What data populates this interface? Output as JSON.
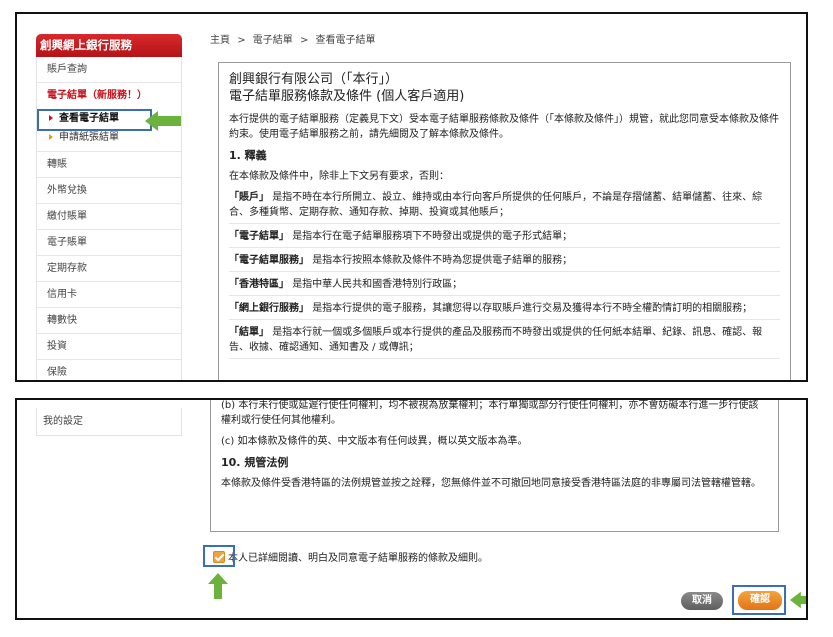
{
  "sidebar": {
    "brand": "創興網上銀行服務",
    "items_top": [
      "賬戶查詢"
    ],
    "active_item": "電子結單（新服務！）",
    "sub_items": [
      "查看電子結單",
      "申請紙張結單"
    ],
    "items": [
      "轉賬",
      "外幣兌換",
      "繳付賬單",
      "電子賬單",
      "定期存款",
      "信用卡",
      "轉數快",
      "投資",
      "保險"
    ],
    "bottom_item": "我的設定"
  },
  "breadcrumb": [
    "主頁",
    ">",
    "電子結單",
    ">",
    "查看電子結單"
  ],
  "terms": {
    "company": "創興銀行有限公司（「本行」）",
    "title": "電子結單服務條款及條件 (個人客戶適用)",
    "intro": "本行提供的電子結單服務（定義見下文）受本電子結單服務條款及條件（「本條款及條件」）規管，就此您同意受本條款及條件約束。使用電子結單服務之前，請先細閱及了解本條款及條件。",
    "sec1": "1. 釋義",
    "sec1_text": "在本條款及條件中，除非上下文另有要求，否則：",
    "defs": [
      {
        "term": "「賬戶」",
        "text": "是指不時在本行所開立、設立、維持或由本行向客戶所提供的任何賬戶，不論是存摺儲蓄、結單儲蓄、往來、綜合、多種貨幣、定期存款、通知存款、掉期、投資或其他賬戶；"
      },
      {
        "term": "「電子結單」",
        "text": "是指本行在電子結單服務項下不時發出或提供的電子形式結單；"
      },
      {
        "term": "「電子結單服務」",
        "text": "是指本行按照本條款及條件不時為您提供電子結單的服務；"
      },
      {
        "term": "「香港特區」",
        "text": "是指中華人民共和國香港特別行政區；"
      },
      {
        "term": "「網上銀行服務」",
        "text": "是指本行提供的電子服務，其讓您得以存取賬戶進行交易及獲得本行不時全權酌情訂明的相關服務；"
      },
      {
        "term": "「結單」",
        "text": "是指本行就一個或多個賬戶或本行提供的產品及服務而不時發出或提供的任何紙本結單、紀錄、訊息、確認、報告、收據、確認通知、通知書及 / 或傳訊；"
      }
    ],
    "clause_b": "(b) 本行未行使或延遲行使任何權利，均不被視為放棄權利；本行單獨或部分行使任何權利，亦不會妨礙本行進一步行使該權利或行使任何其他權利。",
    "clause_c": "(c) 如本條款及條件的英、中文版本有任何歧異，概以英文版本為準。",
    "sec10": "10. 規管法例",
    "sec10_text": "本條款及條件受香港特區的法例規管並按之詮釋，您無條件並不可撤回地同意接受香港特區法庭的非專屬司法管轄權管轄。"
  },
  "agree_label": "本人已詳細閱讀、明白及同意電子結單服務的條款及細則。",
  "buttons": {
    "cancel": "取消",
    "confirm": "確認"
  },
  "colors": {
    "brand_red": "#c8101a",
    "highlight_blue": "#3a6fb6",
    "arrow_green": "#6cb33e",
    "confirm_orange": "#f08a24"
  }
}
